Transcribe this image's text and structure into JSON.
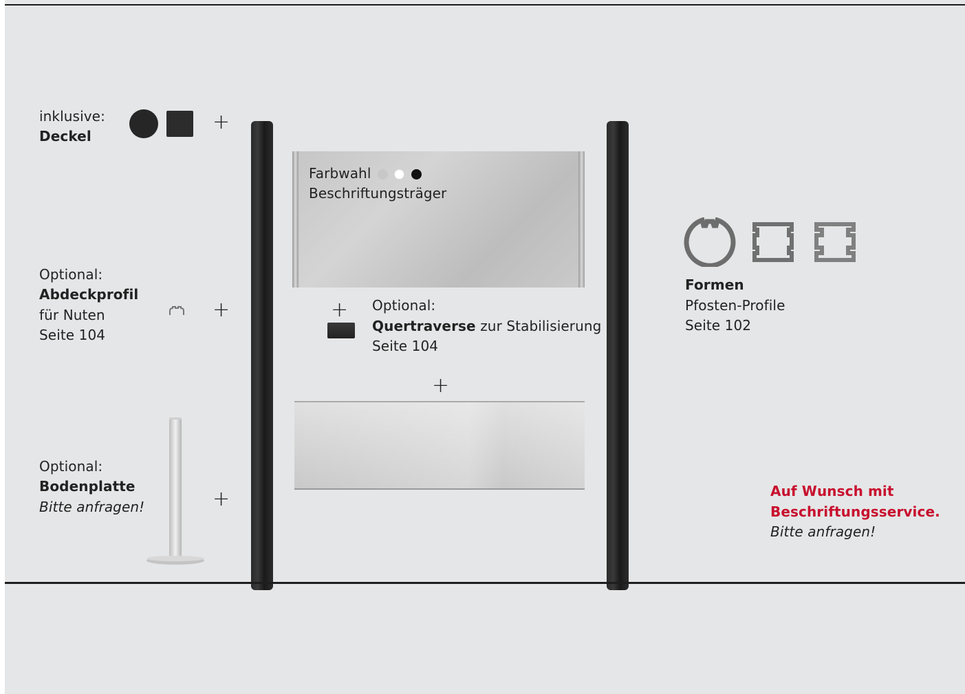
{
  "deckel": {
    "prefix": "inklusive:",
    "title": "Deckel"
  },
  "abdeckprofil": {
    "prefix": "Optional:",
    "title": "Abdeckprofil",
    "line1": "für Nuten",
    "page": "Seite 104"
  },
  "bodenplatte": {
    "prefix": "Optional:",
    "title": "Bodenplatte",
    "note": "Bitte anfragen!"
  },
  "farbwahl": {
    "label": "Farbwahl",
    "swatches": [
      "#c8c8c8",
      "#ffffff",
      "#111111"
    ],
    "subtitle": "Beschriftungsträger"
  },
  "quertraverse": {
    "prefix": "Optional:",
    "title": "Quertraverse",
    "suffix": " zur Stabilisierung",
    "page": "Seite 104"
  },
  "formen": {
    "title": "Formen",
    "line1": "Pfosten-Profile",
    "page": "Seite 102"
  },
  "service": {
    "line1": "Auf Wunsch mit",
    "line2": "Beschriftungsservice.",
    "note": "Bitte anfragen!",
    "accent": "#c8102e"
  },
  "symbols": {
    "plus": "+"
  }
}
